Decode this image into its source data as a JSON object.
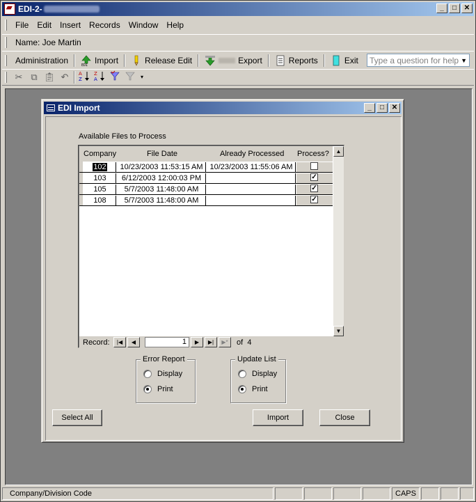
{
  "window": {
    "title": "EDI-2-",
    "minimize": "_",
    "maximize": "□",
    "close": "✕"
  },
  "menu": [
    "File",
    "Edit",
    "Insert",
    "Records",
    "Window",
    "Help"
  ],
  "name_bar": {
    "text": "Name: Joe Martin"
  },
  "toolbar": {
    "administration": "Administration",
    "import": "Import",
    "release_edit": "Release Edit",
    "export": "Export",
    "reports": "Reports",
    "exit": "Exit"
  },
  "help_box": {
    "placeholder": "Type a question for help"
  },
  "child": {
    "title": "EDI Import",
    "available_label": "Available Files to Process",
    "columns": {
      "company": "Company",
      "file_date": "File Date",
      "already_processed": "Already Processed",
      "process": "Process?"
    },
    "rows": [
      {
        "company": "102",
        "file_date": "10/23/2003 11:53:15 AM",
        "already_processed": "10/23/2003 11:55:06 AM",
        "process": false
      },
      {
        "company": "103",
        "file_date": "6/12/2003 12:00:03 PM",
        "already_processed": "",
        "process": true
      },
      {
        "company": "105",
        "file_date": "5/7/2003 11:48:00 AM",
        "already_processed": "",
        "process": true
      },
      {
        "company": "108",
        "file_date": "5/7/2003 11:48:00 AM",
        "already_processed": "",
        "process": true
      }
    ],
    "navigator": {
      "label": "Record:",
      "current": "1",
      "of": "of",
      "total": "4"
    },
    "error_report": {
      "title": "Error Report",
      "display": "Display",
      "print": "Print",
      "selected": "print"
    },
    "update_list": {
      "title": "Update List",
      "display": "Display",
      "print": "Print",
      "selected": "print"
    },
    "buttons": {
      "select_all": "Select All",
      "import": "Import",
      "close": "Close"
    }
  },
  "status": {
    "text": "Company/Division Code",
    "caps": "CAPS"
  }
}
